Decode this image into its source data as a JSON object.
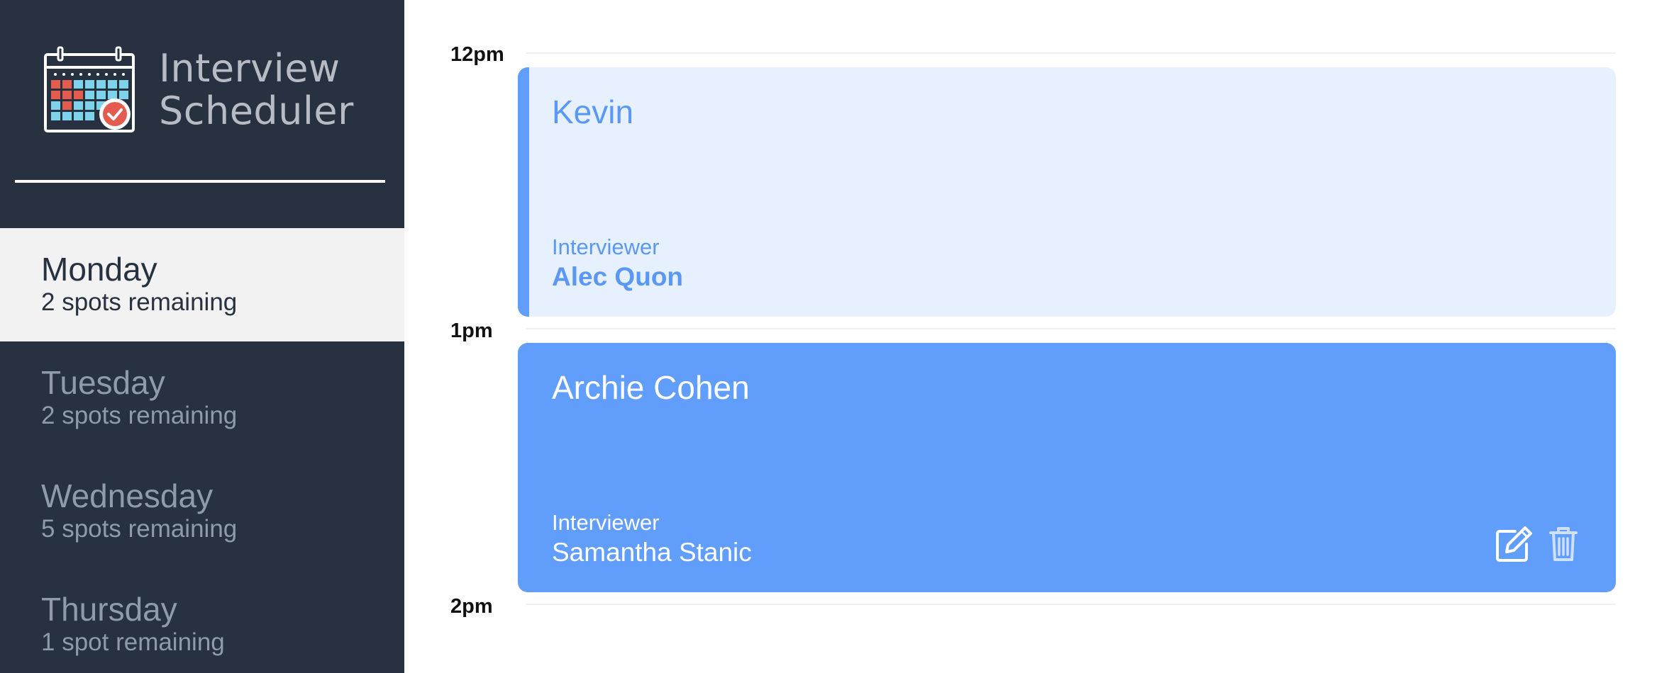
{
  "app": {
    "title_line1": "Interview",
    "title_line2": "Scheduler"
  },
  "sidebar": {
    "days": [
      {
        "name": "Monday",
        "spots": "2 spots remaining",
        "selected": true
      },
      {
        "name": "Tuesday",
        "spots": "2 spots remaining",
        "selected": false
      },
      {
        "name": "Wednesday",
        "spots": "5 spots remaining",
        "selected": false
      },
      {
        "name": "Thursday",
        "spots": "1 spot remaining",
        "selected": false
      }
    ]
  },
  "schedule": {
    "times": [
      "12pm",
      "1pm",
      "2pm"
    ],
    "appointments": [
      {
        "student": "Kevin",
        "interviewer_label": "Interviewer",
        "interviewer": "Alec Quon",
        "style": "light"
      },
      {
        "student": "Archie Cohen",
        "interviewer_label": "Interviewer",
        "interviewer": "Samantha Stanic",
        "style": "dark",
        "actions": [
          "edit-icon",
          "trash-icon"
        ]
      }
    ]
  },
  "colors": {
    "sidebar_bg": "#273140",
    "accent_blue": "#619dfb",
    "light_blue_bg": "#e6f0fe",
    "selected_bg": "#f2f2f2"
  }
}
